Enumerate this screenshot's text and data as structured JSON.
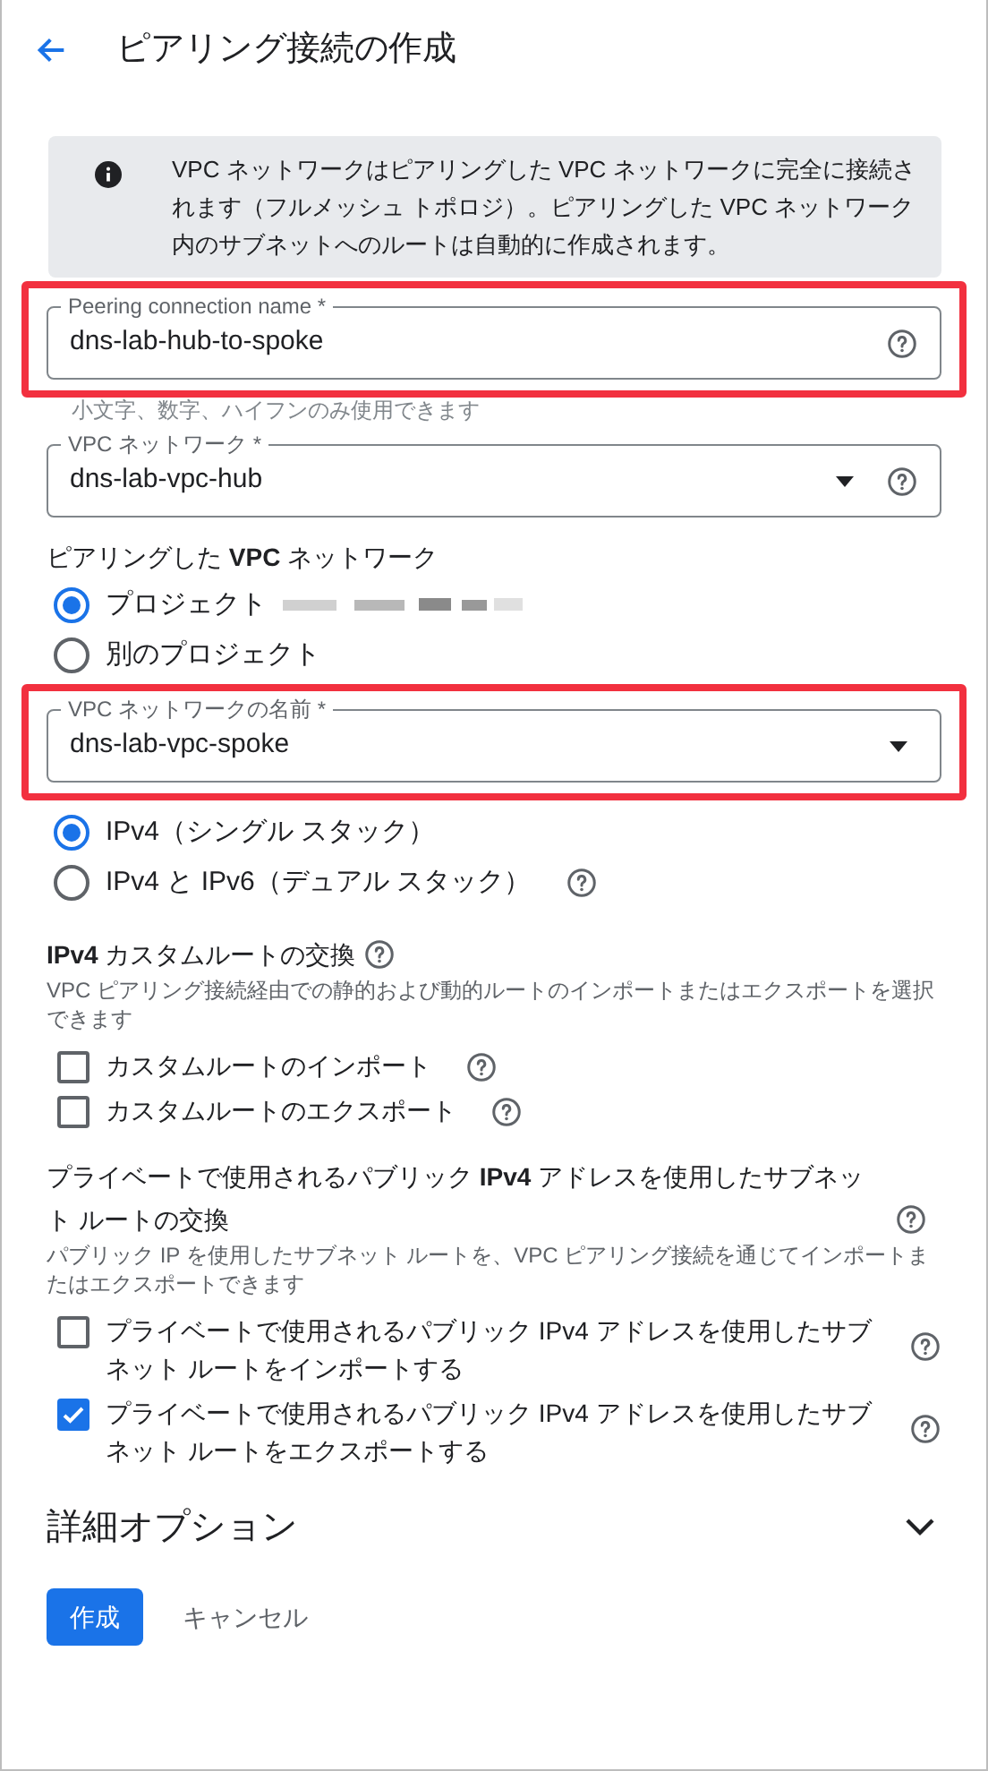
{
  "header": {
    "title": "ピアリング接続の作成"
  },
  "info": {
    "text": "VPC ネットワークはピアリングした VPC ネットワークに完全に接続されます（フルメッシュ トポロジ）。ピアリングした VPC ネットワーク内のサブネットへのルートは自動的に作成されます。"
  },
  "fields": [
    {
      "kind": "text",
      "label": "Peering connection name *",
      "value": "dns-lab-hub-to-spoke",
      "highlighted": true,
      "help": true,
      "hint": "小文字、数字、ハイフンのみ使用できます"
    },
    {
      "kind": "select",
      "label": "VPC ネットワーク *",
      "value": "dns-lab-vpc-hub",
      "highlighted": false,
      "help": true
    }
  ],
  "peer": {
    "title": "ピアリングした **VPC** ネットワーク",
    "options": [
      {
        "label": "プロジェクト",
        "selected": true,
        "redacted": true
      },
      {
        "label": "別のプロジェクト",
        "selected": false,
        "redacted": false
      }
    ],
    "field": {
      "kind": "select",
      "label": "VPC ネットワークの名前 *",
      "value": "dns-lab-vpc-spoke",
      "highlighted": true,
      "help": false
    }
  },
  "stack": [
    {
      "label": "IPv4（シングル スタック）",
      "selected": true,
      "help": false
    },
    {
      "label": "IPv4 と IPv6（デュアル スタック）",
      "selected": false,
      "help": true
    }
  ],
  "sections": [
    {
      "title": "**IPv4** カスタムルートの交換",
      "description": "VPC ピアリング接続経由での静的および動的ルートのインポートまたはエクスポートを選択できます",
      "options": [
        {
          "label": "カスタムルートのインポート",
          "checked": false
        },
        {
          "label": "カスタムルートのエクスポート",
          "checked": false
        }
      ]
    },
    {
      "title": "プライベートで使用されるパブリック **IPv4** アドレスを使用したサブネット ルートの交換",
      "description": "パブリック IP を使用したサブネット ルートを、VPC ピアリング接続を通じてインポートまたはエクスポートできます",
      "options": [
        {
          "label": "プライベートで使用されるパブリック IPv4 アドレスを使用したサブネット ルートをインポートする",
          "checked": false
        },
        {
          "label": "プライベートで使用されるパブリック IPv4 アドレスを使用したサブネット ルートをエクスポートする",
          "checked": true
        }
      ]
    }
  ],
  "advanced": {
    "title": "詳細オプション",
    "expanded": false
  },
  "buttons": [
    {
      "label": "作成",
      "kind": "primary"
    },
    {
      "label": "キャンセル",
      "kind": "text"
    }
  ]
}
